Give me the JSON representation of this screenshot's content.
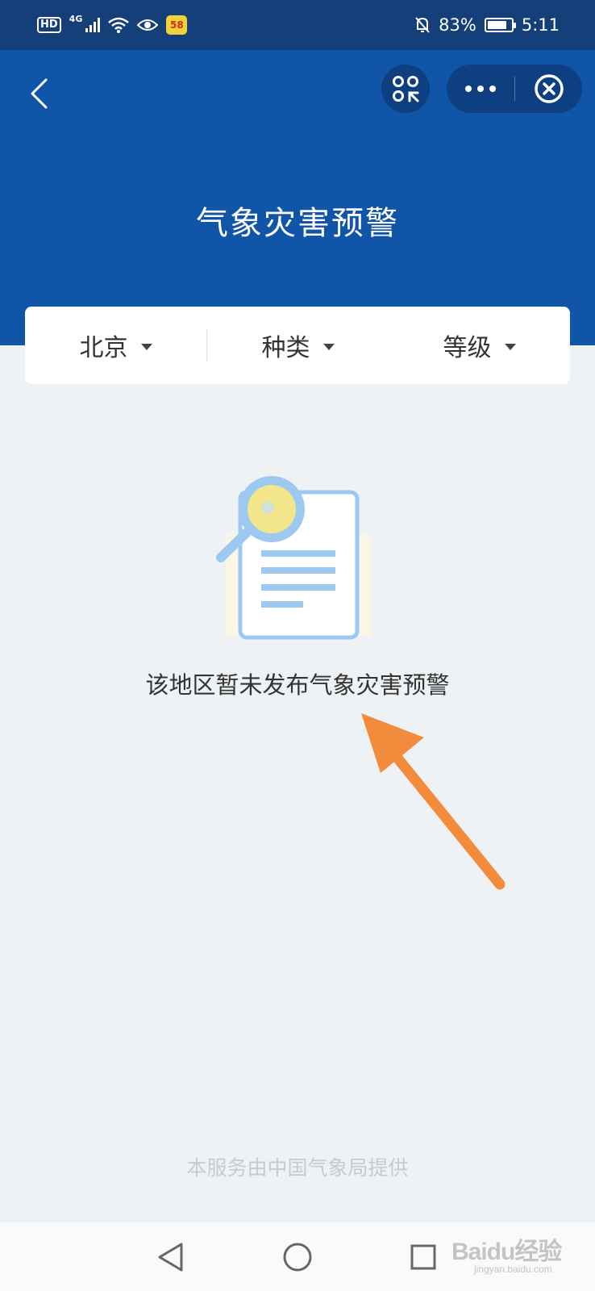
{
  "status_bar": {
    "hd": "HD",
    "network": "4G",
    "app_badge": "58",
    "battery": "83%",
    "battery_level": 0.83,
    "time": "5:11"
  },
  "header": {
    "title": "气象灾害预警"
  },
  "filters": [
    {
      "label": "北京"
    },
    {
      "label": "种类"
    },
    {
      "label": "等级"
    }
  ],
  "empty_state": {
    "message": "该地区暂未发布气象灾害预警"
  },
  "footer": {
    "provider": "本服务由中国气象局提供"
  },
  "watermark": {
    "brand": "Baidu经验",
    "url": "jingyan.baidu.com"
  },
  "colors": {
    "header_bg": "#1155a8",
    "status_bg": "#143f78",
    "page_bg": "#eef2f5",
    "arrow": "#f28b3c"
  }
}
